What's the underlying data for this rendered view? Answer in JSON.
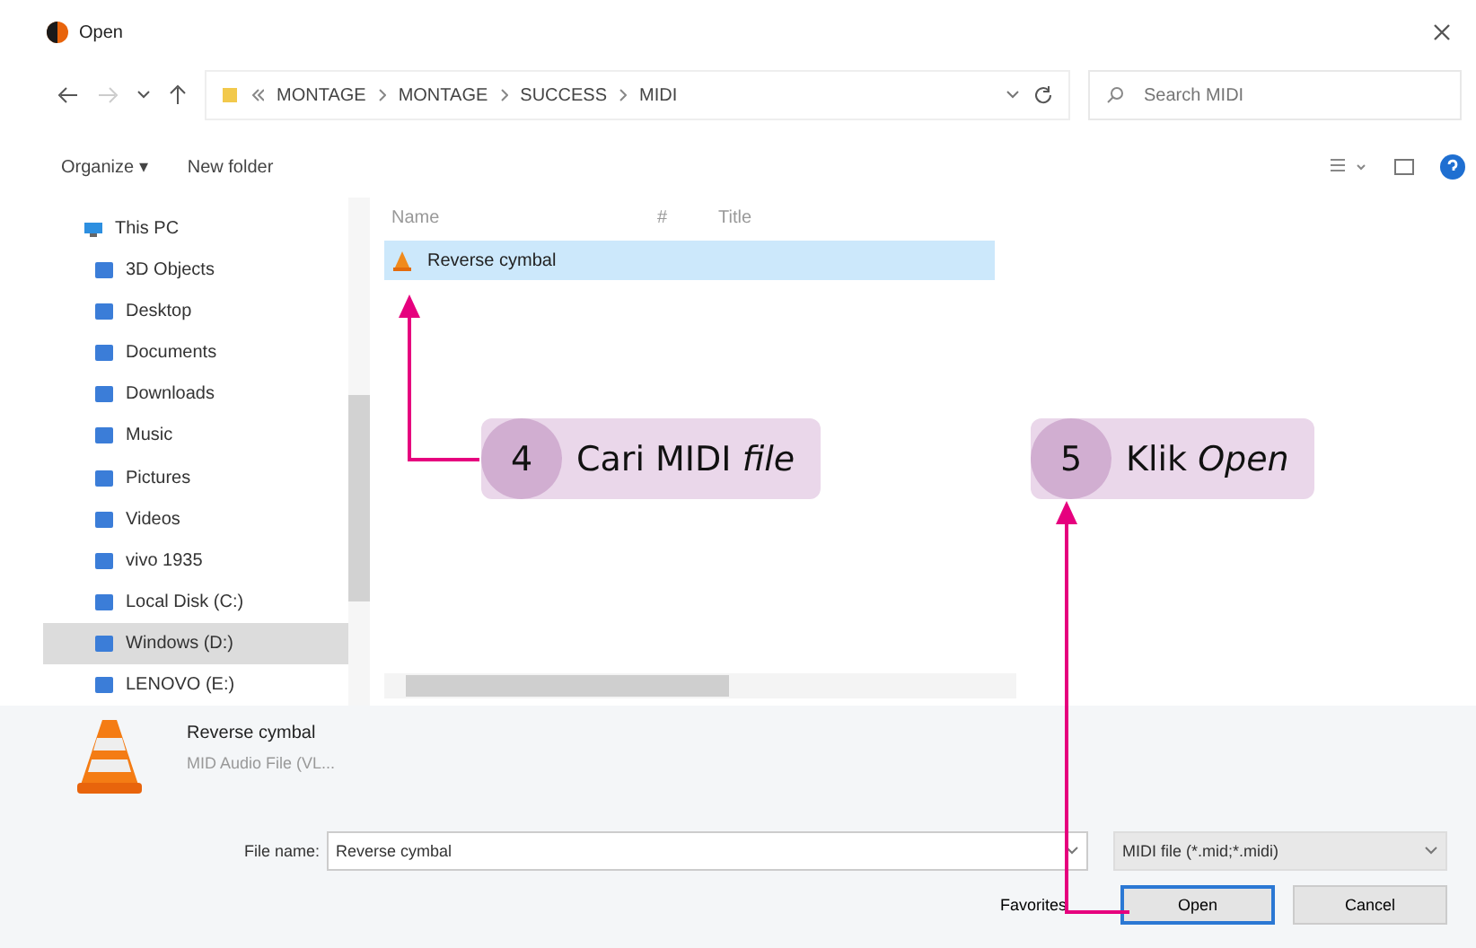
{
  "window": {
    "title": "Open"
  },
  "address": {
    "path": [
      "MONTAGE",
      "MONTAGE",
      "SUCCESS",
      "MIDI"
    ]
  },
  "search": {
    "placeholder": "Search MIDI"
  },
  "toolbar": {
    "organize": "Organize ▾",
    "new_folder": "New folder"
  },
  "nav": [
    {
      "label": "This PC",
      "selected": false,
      "children": [
        {
          "label": "3D Objects",
          "selected": false
        },
        {
          "label": "Desktop",
          "selected": false
        },
        {
          "label": "Documents",
          "selected": false
        },
        {
          "label": "Downloads",
          "selected": false
        },
        {
          "label": "Music",
          "selected": false
        },
        {
          "label": "Pictures",
          "selected": false
        },
        {
          "label": "Videos",
          "selected": false
        },
        {
          "label": "vivo 1935",
          "selected": false
        },
        {
          "label": "Local Disk (C:)",
          "selected": false
        },
        {
          "label": "Windows (D:)",
          "selected": true
        },
        {
          "label": "LENOVO (E:)",
          "selected": false
        }
      ]
    }
  ],
  "table": {
    "columns": [
      "Name",
      "#",
      "Title"
    ],
    "rows": [
      {
        "name": "Reverse cymbal",
        "selected": true
      }
    ]
  },
  "details": {
    "name": "Reverse cymbal",
    "type": "MID Audio File (VL..."
  },
  "file_name": {
    "label": "File name:",
    "value": "Reverse cymbal"
  },
  "file_type": "MIDI file (*.mid;*.midi)",
  "favorites": "Favorites",
  "buttons": [
    "Open",
    "Cancel"
  ],
  "callouts": [
    {
      "number": "4",
      "text": "Cari MIDI *file*"
    },
    {
      "number": "5",
      "text": "Klik *Open*"
    }
  ]
}
